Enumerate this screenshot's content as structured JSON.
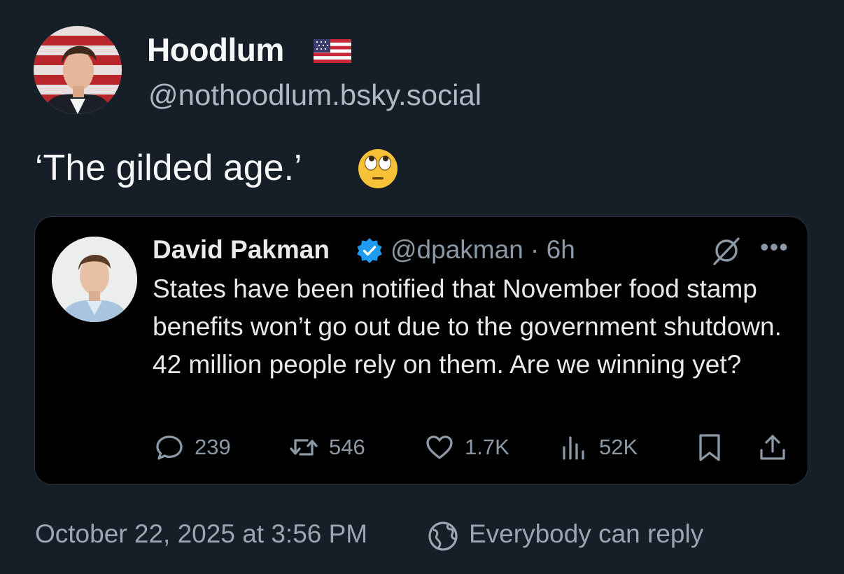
{
  "post": {
    "display_name": "Hoodlum",
    "name_emoji": "us-flag-emoji",
    "handle": "@nothoodlum.bsky.social",
    "text": "‘The gilded age.’",
    "text_emoji": "face-with-rolling-eyes-emoji",
    "timestamp": "October 22, 2025 at 3:56 PM",
    "reply_setting": "Everybody can reply",
    "reply_icon": "globe-icon"
  },
  "quote": {
    "name": "David Pakman",
    "verified_icon": "verified-badge-icon",
    "handle_time": "@dpakman · 6h",
    "text": "States have been notified that November food stamp benefits won’t go out due to the government shutdown. 42 million people rely on them. Are we winning yet?",
    "actions": {
      "replies": "239",
      "reposts": "546",
      "likes": "1.7K",
      "views": "52K"
    },
    "icons": [
      "reply-icon",
      "repost-icon",
      "like-icon",
      "views-icon",
      "bookmark-icon",
      "share-icon",
      "grok-icon",
      "more-icon"
    ]
  },
  "colors": {
    "background": "#161e27",
    "card_background": "#000000",
    "muted_text": "#8b98a5",
    "verified_blue": "#1d9bf0"
  }
}
